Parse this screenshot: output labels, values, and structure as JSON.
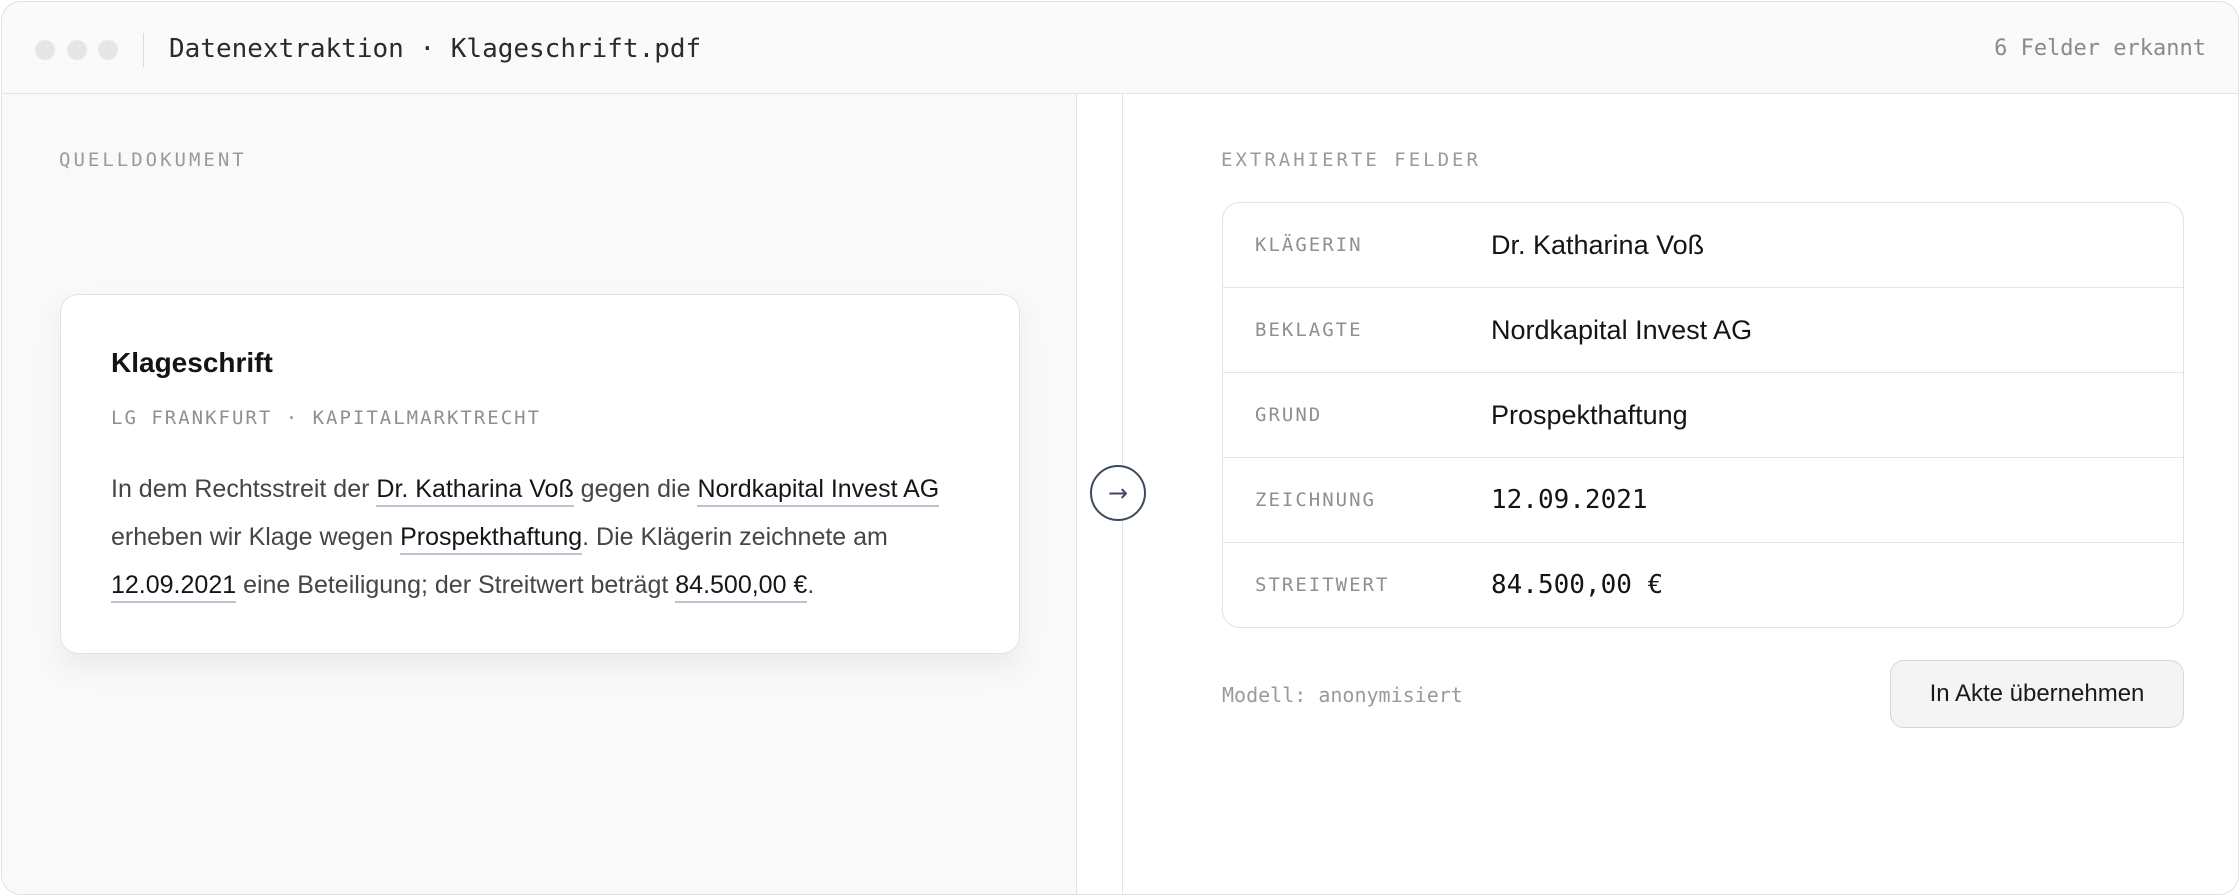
{
  "window": {
    "title": "Datenextraktion · Klageschrift.pdf",
    "status": "6 Felder erkannt"
  },
  "source": {
    "section_label": "QUELLDOKUMENT",
    "doc_title": "Klageschrift",
    "court": "LG FRANKFURT · KAPITALMARKTRECHT",
    "body": {
      "t1": "In dem Rechtsstreit der ",
      "h1": "Dr. Katharina Voß",
      "t2": " gegen die ",
      "h2": "Nordkapital Invest AG",
      "t3": " erheben wir Klage wegen ",
      "h3": "Prospekthaftung",
      "t4": ". Die Klägerin zeichnete am ",
      "h4": "12.09.2021",
      "t5": " eine Beteiligung; der Streitwert beträgt ",
      "h5": "84.500,00 €",
      "t6": "."
    }
  },
  "transfer_icon": "arrow-right-icon",
  "extracted": {
    "section_label": "EXTRAHIERTE FELDER",
    "fields": [
      {
        "label": "KLÄGERIN",
        "value": "Dr. Katharina Voß"
      },
      {
        "label": "BEKLAGTE",
        "value": "Nordkapital Invest AG"
      },
      {
        "label": "GRUND",
        "value": "Prospekthaftung"
      },
      {
        "label": "ZEICHNUNG",
        "value": "12.09.2021"
      },
      {
        "label": "STREITWERT",
        "value": "84.500,00 €"
      }
    ],
    "model_note": "Modell: anonymisiert",
    "accept_label": "In Akte übernehmen"
  },
  "colors": {
    "accent": "#3d4a5e",
    "highlight_underline": "#b9c4d2"
  }
}
